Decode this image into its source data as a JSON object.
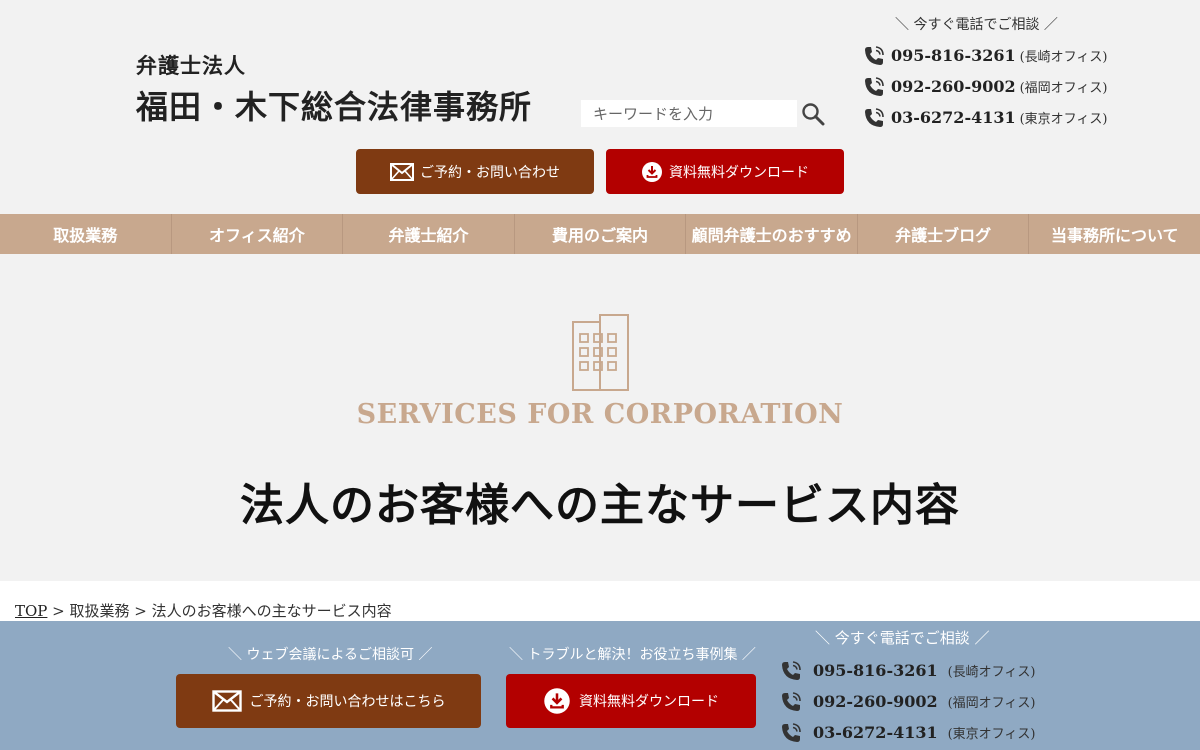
{
  "header": {
    "logo_sub": "弁護士法人",
    "logo_main": "福田・木下総合法律事務所",
    "search_placeholder": "キーワードを入力",
    "tel_heading": "＼ 今すぐ電話でご相談 ／",
    "phones": [
      {
        "number": "095-816-3261",
        "office": "(長崎オフィス)"
      },
      {
        "number": "092-260-9002",
        "office": "(福岡オフィス)"
      },
      {
        "number": "03-6272-4131",
        "office": "(東京オフィス)"
      }
    ],
    "contact_button": "ご予約・お問い合わせ",
    "download_button": "資料無料ダウンロード"
  },
  "nav": {
    "items": [
      "取扱業務",
      "オフィス紹介",
      "弁護士紹介",
      "費用のご案内",
      "顧問弁護士のおすすめ",
      "弁護士ブログ",
      "当事務所について"
    ]
  },
  "hero": {
    "en_title": "SERVICES FOR CORPORATION",
    "jp_title": "法人のお客様への主なサービス内容"
  },
  "breadcrumb": {
    "top": "TOP",
    "sep": " > ",
    "level1": "取扱業務",
    "current": "法人のお客様への主なサービス内容"
  },
  "footer": {
    "web_caption": "＼ ウェブ会議によるご相談可 ／",
    "case_caption": "＼ トラブルと解決！お役立ち事例集 ／",
    "tel_caption": "＼ 今すぐ電話でご相談 ／",
    "contact_button": "ご予約・お問い合わせはこちら",
    "download_button": "資料無料ダウンロード",
    "phones": [
      {
        "number": "095-816-3261",
        "office": "(長崎オフィス)"
      },
      {
        "number": "092-260-9002",
        "office": "(福岡オフィス)"
      },
      {
        "number": "03-6272-4131",
        "office": "(東京オフィス)"
      }
    ]
  },
  "colors": {
    "nav_bg": "#c8a88e",
    "contact_bg": "#7f3a12",
    "download_bg": "#b30000",
    "footer_bg": "#8fa9c3",
    "accent_text": "#c8a88e"
  }
}
